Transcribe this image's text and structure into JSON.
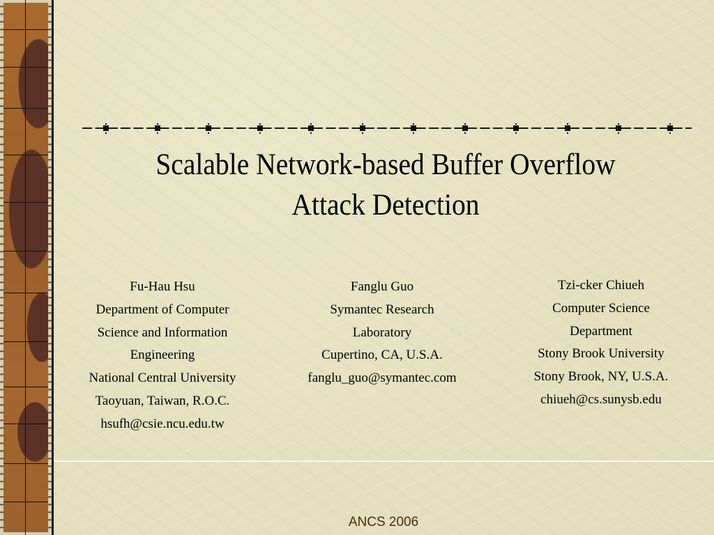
{
  "slide": {
    "title_lines": [
      "Scalable Network-based Buffer Overflow",
      "Attack Detection"
    ],
    "authors": [
      {
        "name": "Fu-Hau Hsu",
        "lines": [
          "Department of Computer",
          "Science and Information",
          "Engineering",
          "National Central University",
          "Taoyuan, Taiwan, R.O.C.",
          "hsufh@csie.ncu.edu.tw"
        ]
      },
      {
        "name": "Fanglu Guo",
        "lines": [
          "Symantec Research",
          "Laboratory",
          "Cupertino, CA, U.S.A.",
          "fanglu_guo@symantec.com"
        ]
      },
      {
        "name": "Tzi-cker Chiueh",
        "lines": [
          "Computer Science",
          "Department",
          "Stony Brook University",
          "Stony Brook, NY, U.S.A.",
          "chiueh@cs.sunysb.edu"
        ]
      }
    ],
    "footer": "ANCS 2006"
  },
  "theme": {
    "background": "#e6e2c2",
    "sidebar_brown": "#a86a2c",
    "sidebar_dark": "#5a3226",
    "footer_color": "#4a2c0c",
    "text_color": "#000000"
  }
}
